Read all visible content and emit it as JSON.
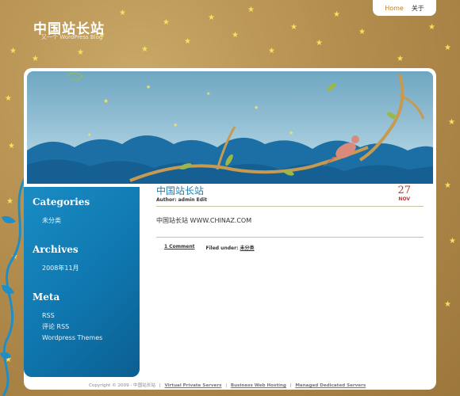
{
  "nav": {
    "home": "Home",
    "about": "关于"
  },
  "brand": {
    "title": "中国站长站",
    "tagline": "又一个 WordPress Blog"
  },
  "sidebar": {
    "sections": [
      {
        "title": "Categories",
        "items": [
          "未分类"
        ]
      },
      {
        "title": "Archives",
        "items": [
          "2008年11月"
        ]
      },
      {
        "title": "Meta",
        "items": [
          "RSS",
          "评论 RSS",
          "Wordpress Themes"
        ]
      }
    ]
  },
  "post": {
    "title": "中国站长站",
    "meta": "Author: admin Edit",
    "day": "27",
    "month": "NOV",
    "body": "中国站长站  WWW.CHINAZ.COM",
    "comment_link": "1 Comment",
    "filed_label": "Filed under:",
    "filed_category": "未分类"
  },
  "footer": {
    "copyright": "Copyright © 2009 · 中国站长站",
    "links": [
      "Virtual Private Servers",
      "Business Web Hosting",
      "Managed Dedicated Servers"
    ]
  },
  "colors": {
    "accent_blue": "#1a7fb5",
    "date_red": "#c0392b",
    "nav_home": "#d07a1a",
    "sidebar_blue": "#0f76ae"
  }
}
